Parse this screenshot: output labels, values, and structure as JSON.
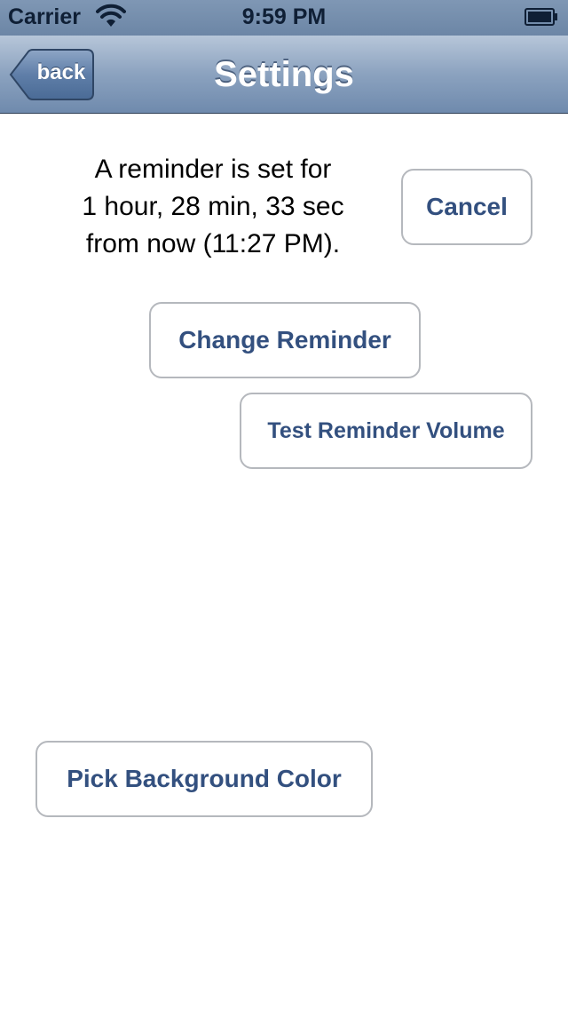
{
  "status_bar": {
    "carrier": "Carrier",
    "time": "9:59 PM",
    "wifi_icon": "wifi-icon",
    "battery_icon": "battery-icon"
  },
  "nav_bar": {
    "title": "Settings",
    "back_label": "back"
  },
  "reminder": {
    "line1": "A reminder is set for",
    "line2": "1 hour, 28 min, 33 sec",
    "line3": "from now (11:27 PM)."
  },
  "buttons": {
    "cancel": "Cancel",
    "change_reminder": "Change Reminder",
    "test_volume": "Test Reminder Volume",
    "pick_background": "Pick Background Color"
  },
  "colors": {
    "nav_bar": "#8ba2bf",
    "button_text": "#33507f",
    "button_border": "#b5b8bd"
  }
}
